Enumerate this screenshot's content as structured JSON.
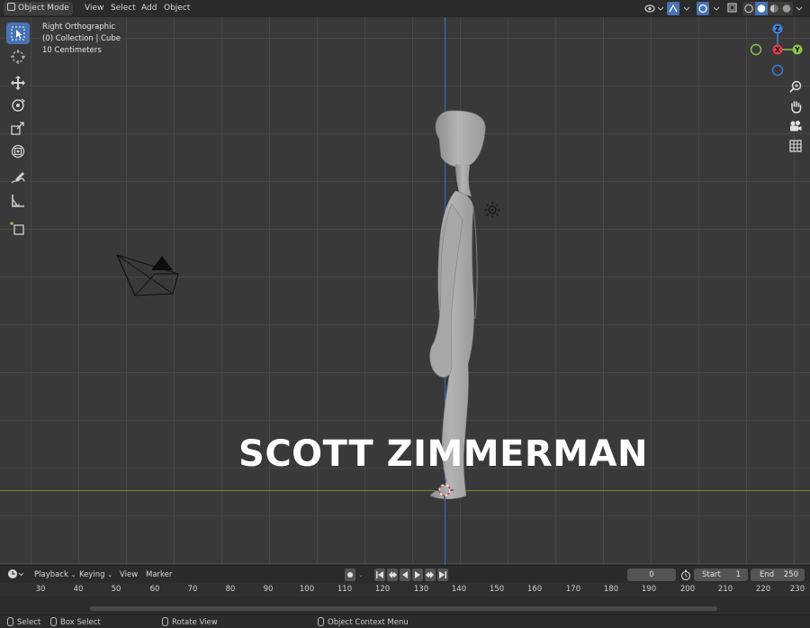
{
  "header": {
    "mode": "Object Mode",
    "menus": [
      "View",
      "Select",
      "Add",
      "Object"
    ]
  },
  "viewport": {
    "view_name": "Right Orthographic",
    "collection": "(0) Collection | Cube",
    "scale": "10 Centimeters",
    "watermark": "SCOTT ZIMMERMAN",
    "gizmo": {
      "top": "Z",
      "center": "X",
      "right": "Y"
    }
  },
  "timeline": {
    "playback": "Playback",
    "keying": "Keying",
    "view": "View",
    "marker": "Marker",
    "current_frame": "0",
    "start_label": "Start",
    "start_value": "1",
    "end_label": "End",
    "end_value": "250",
    "ruler": [
      "30",
      "40",
      "50",
      "60",
      "70",
      "80",
      "90",
      "100",
      "110",
      "120",
      "130",
      "140",
      "150",
      "160",
      "170",
      "180",
      "190",
      "200",
      "210",
      "220",
      "230"
    ]
  },
  "statusbar": {
    "select": "Select",
    "box_select": "Box Select",
    "rotate_view": "Rotate View",
    "context_menu": "Object Context Menu"
  },
  "colors": {
    "accent": "#4772b3",
    "axis_x": "#e03a4a",
    "axis_y": "#8bc34a",
    "axis_z": "#3f7fd8",
    "ground_line": "#6e8a2e",
    "vertical_line": "#3a6fc0"
  }
}
